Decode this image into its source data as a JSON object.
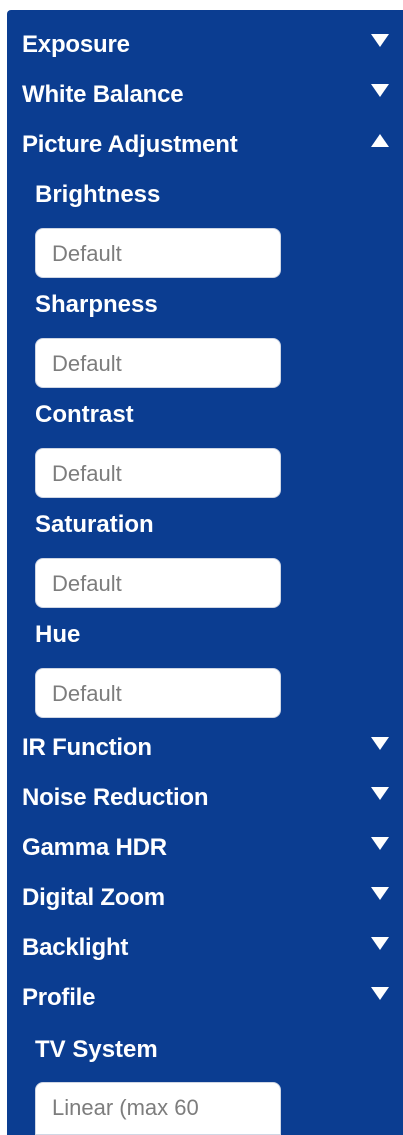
{
  "menu": {
    "exposure": "Exposure",
    "white_balance": "White Balance",
    "picture_adjustment": "Picture Adjustment",
    "ir_function": "IR Function",
    "noise_reduction": "Noise Reduction",
    "gamma_hdr": "Gamma HDR",
    "digital_zoom": "Digital Zoom",
    "backlight": "Backlight",
    "profile": "Profile",
    "tv_system": "TV System"
  },
  "picture_adjustment": {
    "brightness_label": "Brightness",
    "brightness_value": "Default",
    "sharpness_label": "Sharpness",
    "sharpness_value": "Default",
    "contrast_label": "Contrast",
    "contrast_value": "Default",
    "saturation_label": "Saturation",
    "saturation_value": "Default",
    "hue_label": "Hue",
    "hue_value": "Default"
  },
  "tv_system": {
    "value": "Linear (max 60"
  },
  "icons": {
    "collapsed": "chevron-down-icon",
    "expanded": "chevron-up-icon"
  },
  "colors": {
    "panel_bg": "#0b3d91",
    "text": "#ffffff",
    "field_text": "#7d7d7d"
  }
}
